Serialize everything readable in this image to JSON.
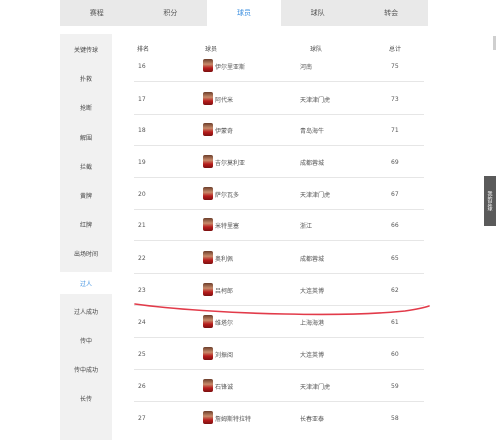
{
  "tabs": [
    {
      "label": "赛程"
    },
    {
      "label": "积分"
    },
    {
      "label": "球员"
    },
    {
      "label": "球队"
    },
    {
      "label": "转会"
    }
  ],
  "sidebar": {
    "items": [
      {
        "label": "关键传球"
      },
      {
        "label": "扑救"
      },
      {
        "label": "抢断"
      },
      {
        "label": "解围"
      },
      {
        "label": "拦截"
      },
      {
        "label": "黄牌"
      },
      {
        "label": "红牌"
      },
      {
        "label": "出场时间"
      },
      {
        "label": "过人"
      },
      {
        "label": "过人成功"
      },
      {
        "label": "传中"
      },
      {
        "label": "传中成功"
      },
      {
        "label": "长传"
      }
    ]
  },
  "table": {
    "headers": [
      "排名",
      "球员",
      "球队",
      "总计"
    ],
    "rows": [
      {
        "rank": "16",
        "player": "伊尔里亚斯",
        "team": "河南",
        "total": "75"
      },
      {
        "rank": "17",
        "player": "阿代米",
        "team": "天津津门虎",
        "total": "73"
      },
      {
        "rank": "18",
        "player": "伊蒙奇",
        "team": "青岛海牛",
        "total": "71"
      },
      {
        "rank": "19",
        "player": "吉尔莫利亚",
        "team": "成都蓉城",
        "total": "69"
      },
      {
        "rank": "20",
        "player": "萨尔瓦多",
        "team": "天津津门虎",
        "total": "67"
      },
      {
        "rank": "21",
        "player": "米特里塞",
        "team": "浙江",
        "total": "66"
      },
      {
        "rank": "22",
        "player": "奥利佩",
        "team": "成都蓉城",
        "total": "65"
      },
      {
        "rank": "23",
        "player": "吕柯郎",
        "team": "大连英博",
        "total": "62"
      },
      {
        "rank": "24",
        "player": "维塔尔",
        "team": "上海海港",
        "total": "61"
      },
      {
        "rank": "25",
        "player": "刘振阅",
        "team": "大连英博",
        "total": "60"
      },
      {
        "rank": "26",
        "player": "石锋诚",
        "team": "天津津门虎",
        "total": "59"
      },
      {
        "rank": "27",
        "player": "詹姆斯特拉特",
        "team": "长春亚泰",
        "total": "58"
      }
    ]
  },
  "colors": {
    "accent": "#3b8fe0",
    "annotation_line": "#e23b4a"
  },
  "side_tab": {
    "label": "我的足球"
  }
}
